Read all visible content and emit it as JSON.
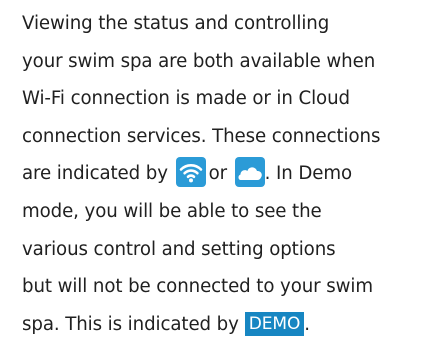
{
  "paragraph": {
    "line1": "Viewing the status and controlling",
    "line2": "your swim spa are both available when",
    "line3": "Wi-Fi connection is made or in Cloud",
    "line4": "connection services. These connections",
    "line5_before": "are indicated by",
    "line5_between": "or",
    "line5_after": ". In Demo",
    "line6": "mode, you will be able to see the",
    "line7": "various control and setting options",
    "line8": "but will not be connected to your swim",
    "line9_before": "spa. This is indicated by",
    "line9_badge": "DEMO",
    "line9_after": "."
  },
  "icons": {
    "wifi": "wifi-icon",
    "cloud": "cloud-icon",
    "badge_color": "#2b9bd7",
    "demo_color": "#1786c2"
  }
}
